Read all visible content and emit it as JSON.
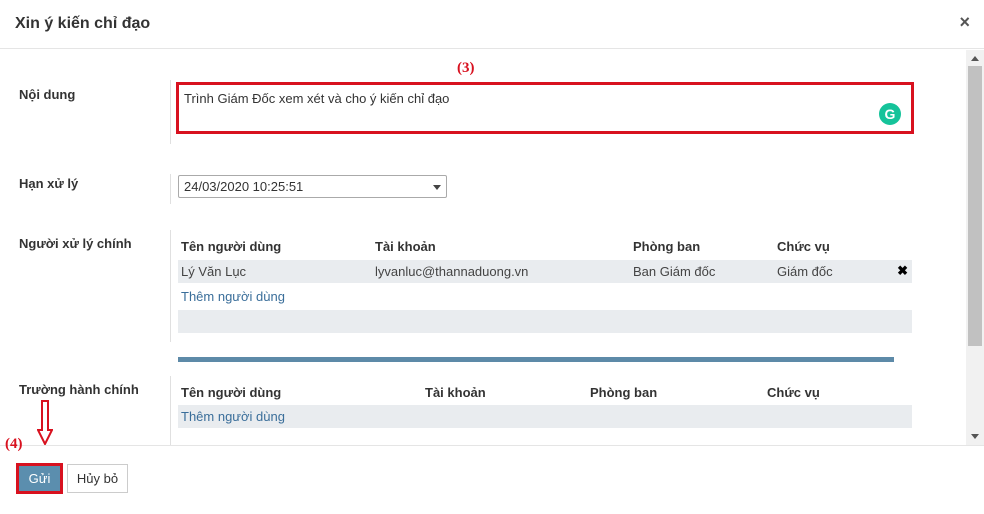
{
  "dialog": {
    "title": "Xin ý kiến chỉ đạo",
    "close": "×"
  },
  "annotations": {
    "step3": "(3)",
    "step4": "(4)"
  },
  "fields": {
    "content_label": "Nội dung",
    "content_value": "Trình Giám Đốc xem xét và cho ý kiến chỉ đạo",
    "grammarly_icon": "G",
    "deadline_label": "Hạn xử lý",
    "deadline_value": "24/03/2020 10:25:51",
    "main_handler_label": "Người xử lý chính",
    "admin_label": "Trường hành chính"
  },
  "main_table": {
    "headers": [
      "Tên người dùng",
      "Tài khoản",
      "Phòng ban",
      "Chức vụ"
    ],
    "rows": [
      {
        "name": "Lý Văn Lục",
        "account": "lyvanluc@thannaduong.vn",
        "department": "Ban Giám đốc",
        "position": "Giám đốc",
        "remove": "✖"
      }
    ],
    "add_user": "Thêm người dùng"
  },
  "admin_table": {
    "headers": [
      "Tên người dùng",
      "Tài khoản",
      "Phòng ban",
      "Chức vụ"
    ],
    "add_user": "Thêm người dùng"
  },
  "footer": {
    "send": "Gửi",
    "cancel": "Hủy bỏ"
  },
  "colors": {
    "highlight": "#d8111f",
    "primary": "#5b8eae",
    "link": "#3a6e9a",
    "divider": "#5d8aa8"
  }
}
